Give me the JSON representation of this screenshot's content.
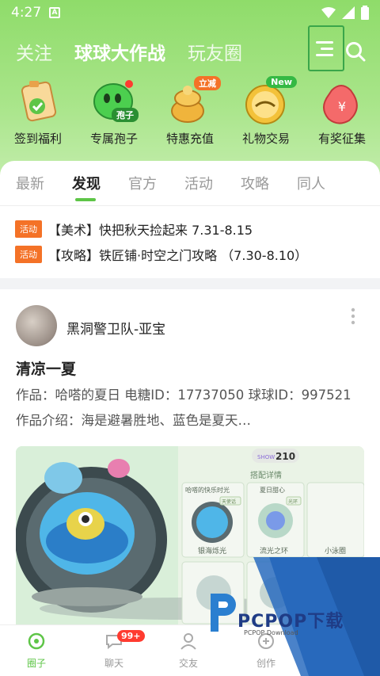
{
  "status": {
    "time": "4:27",
    "app_icon_letter": "A"
  },
  "nav": {
    "tabs": [
      {
        "label": "关注"
      },
      {
        "label": "球球大作战"
      },
      {
        "label": "玩友圈"
      }
    ]
  },
  "quick": [
    {
      "label": "签到福利",
      "icon": "checkin-icon"
    },
    {
      "label": "专属孢子",
      "icon": "spore-icon",
      "badge": "孢子"
    },
    {
      "label": "特惠充值",
      "icon": "recharge-icon",
      "badge": "立减"
    },
    {
      "label": "礼物交易",
      "icon": "gift-trade-icon",
      "badge": "New"
    },
    {
      "label": "有奖征集",
      "icon": "prize-icon"
    }
  ],
  "subtabs": [
    {
      "label": "最新"
    },
    {
      "label": "发现"
    },
    {
      "label": "官方"
    },
    {
      "label": "活动"
    },
    {
      "label": "攻略"
    },
    {
      "label": "同人"
    }
  ],
  "notices": [
    {
      "tag": "活动",
      "text": "【美术】快把秋天捡起来 7.31-8.15"
    },
    {
      "tag": "活动",
      "text": "【攻略】铁匠铺·时空之门攻略 （7.30-8.10）"
    }
  ],
  "post": {
    "author": "黑洞警卫队-亚宝",
    "title": "清凉一夏",
    "desc": "作品：哈嗒的夏日 电糖ID：17737050 球球ID：997521 作品介绍：海是避暑胜地、蓝色是夏天…",
    "image": {
      "show_count": "210",
      "panel_title": "搭配详情",
      "item1": "哈嗒的快乐时光",
      "item2": "夏日甜心",
      "item3": "银海烁光",
      "item4": "流光之环",
      "item5": "小泳圈",
      "tag1": "天使话",
      "tag2": "光环"
    }
  },
  "bottom": [
    {
      "label": "圈子",
      "active": true
    },
    {
      "label": "聊天",
      "badge": "99+"
    },
    {
      "label": "交友"
    },
    {
      "label": "创作"
    }
  ],
  "watermark": {
    "brand": "PCPOP下载",
    "sub": "PCPOP Download"
  },
  "colors": {
    "accent": "#5ec547",
    "tag": "#f47227",
    "header": "#9fe07f"
  }
}
